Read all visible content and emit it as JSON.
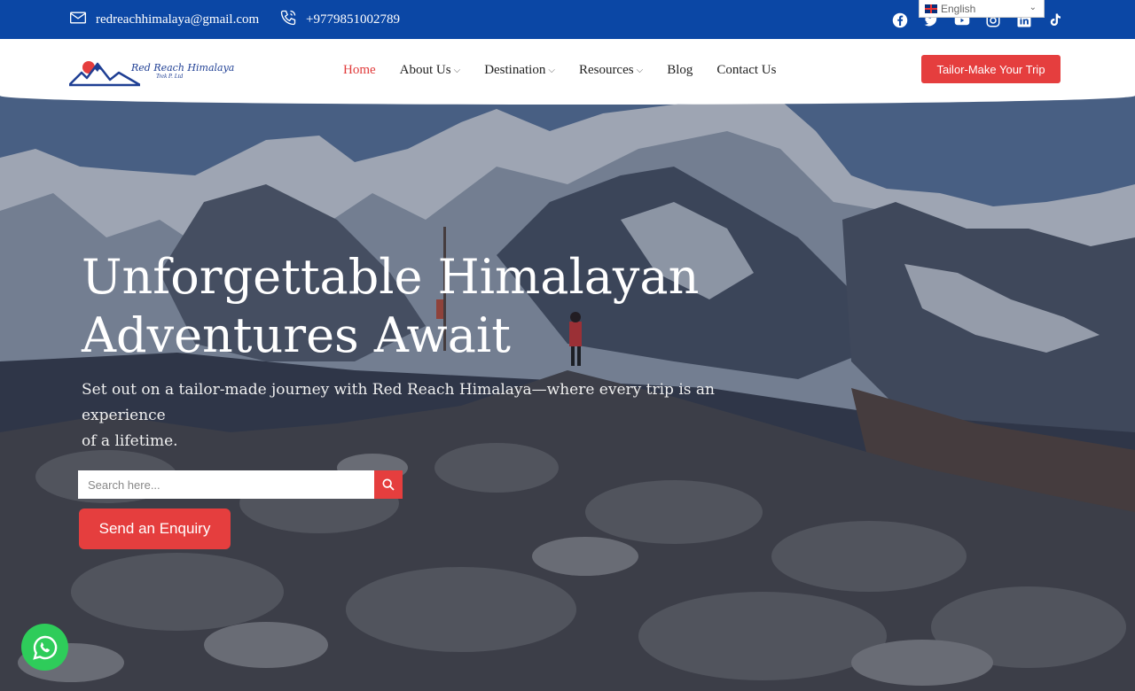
{
  "topbar": {
    "email": "redreachhimalaya@gmail.com",
    "phone": "+9779851002789",
    "language": "English",
    "socials": [
      "facebook-icon",
      "twitter-icon",
      "youtube-icon",
      "instagram-icon",
      "linkedin-icon",
      "tiktok-icon"
    ]
  },
  "logo": {
    "name": "Red Reach Himalaya",
    "sub": "Trek P. Ltd"
  },
  "nav": {
    "items": [
      {
        "label": "Home",
        "active": true,
        "dropdown": false
      },
      {
        "label": "About Us",
        "active": false,
        "dropdown": true
      },
      {
        "label": "Destination",
        "active": false,
        "dropdown": true
      },
      {
        "label": "Resources",
        "active": false,
        "dropdown": true
      },
      {
        "label": "Blog",
        "active": false,
        "dropdown": false
      },
      {
        "label": "Contact Us",
        "active": false,
        "dropdown": false
      }
    ],
    "cta": "Tailor-Make Your Trip"
  },
  "hero": {
    "title_line1": "Unforgettable Himalayan",
    "title_line2": "Adventures Await",
    "subtitle_line1": "Set out on a tailor-made journey with Red Reach Himalaya—where every trip is an experience",
    "subtitle_line2": "of a lifetime.",
    "search_placeholder": "Search here...",
    "enquiry_button": "Send an Enquiry"
  },
  "colors": {
    "topbar": "#0b47a5",
    "accent": "#e53e3e",
    "whatsapp": "#2ecc5a"
  }
}
